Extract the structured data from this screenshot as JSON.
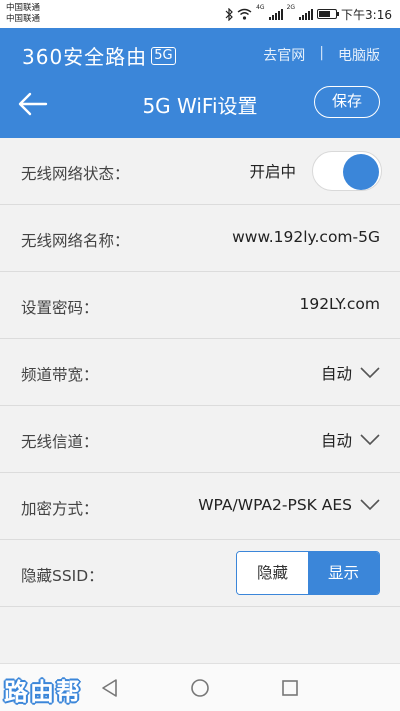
{
  "status_bar": {
    "carrier1": "中国联通",
    "carrier2": "中国联通",
    "network1": "4G",
    "network2": "2G",
    "time": "下午3:16",
    "battery_level": 0.7
  },
  "header": {
    "brand": "360安全路由",
    "brand_badge": "5G",
    "link_official": "去官网",
    "link_separator": "|",
    "link_pc": "电脑版",
    "title": "5G WiFi设置",
    "save_label": "保存"
  },
  "settings": {
    "wifi_status": {
      "label": "无线网络状态：",
      "value": "开启中",
      "enabled": true
    },
    "wifi_name": {
      "label": "无线网络名称：",
      "value": "www.192ly.com-5G"
    },
    "password": {
      "label": "设置密码：",
      "value": "192LY.com"
    },
    "bandwidth": {
      "label": "频道带宽：",
      "value": "自动"
    },
    "channel": {
      "label": "无线信道：",
      "value": "自动"
    },
    "encryption": {
      "label": "加密方式：",
      "value": "WPA/WPA2-PSK AES"
    },
    "hide_ssid": {
      "label": "隐藏SSID：",
      "option_hide": "隐藏",
      "option_show": "显示",
      "selected": "显示"
    }
  },
  "watermark": "路由帮",
  "colors": {
    "accent": "#3b86d9",
    "background": "#f2f2f2"
  }
}
